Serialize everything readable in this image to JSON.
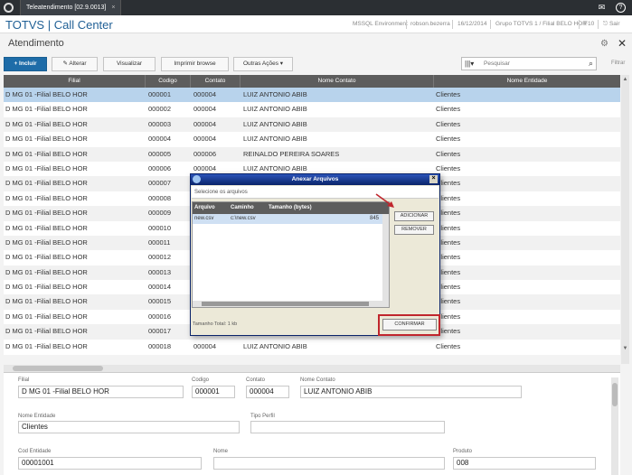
{
  "window": {
    "tab_label": "Teleatendimento [02.9.0013]",
    "tab_close": "×",
    "mail_icon": "✉",
    "help_icon": "?"
  },
  "header": {
    "brand": "TOTVS | Call Center",
    "environment": "MSSQL Environment",
    "user": "robson.bezerra",
    "date": "16/12/2014",
    "group": "Grupo TOTVS 1 / Filial BELO HOR",
    "key": "F10",
    "exit": "Sair"
  },
  "page": {
    "title": "Atendimento",
    "gear_icon": "⚙",
    "close_icon": "✕"
  },
  "toolbar": {
    "incluir": "+ Incluir",
    "alterar": "Alterar",
    "visualizar": "Visualizar",
    "imprimir": "Imprimir browse",
    "outras": "Outras Ações",
    "search_placeholder": "Pesquisar",
    "filtrar": "Filtrar"
  },
  "grid": {
    "columns": [
      "Filial",
      "Codigo",
      "Contato",
      "Nome Contato",
      "Nome Entidade"
    ],
    "rows": [
      [
        "D MG 01 -Filial BELO HOR",
        "000001",
        "000004",
        "LUIZ ANTONIO ABIB",
        "Clientes"
      ],
      [
        "D MG 01 -Filial BELO HOR",
        "000002",
        "000004",
        "LUIZ ANTONIO ABIB",
        "Clientes"
      ],
      [
        "D MG 01 -Filial BELO HOR",
        "000003",
        "000004",
        "LUIZ ANTONIO ABIB",
        "Clientes"
      ],
      [
        "D MG 01 -Filial BELO HOR",
        "000004",
        "000004",
        "LUIZ ANTONIO ABIB",
        "Clientes"
      ],
      [
        "D MG 01 -Filial BELO HOR",
        "000005",
        "000006",
        "REINALDO PEREIRA SOARES",
        "Clientes"
      ],
      [
        "D MG 01 -Filial BELO HOR",
        "000006",
        "000004",
        "LUIZ ANTONIO ABIB",
        "Clientes"
      ],
      [
        "D MG 01 -Filial BELO HOR",
        "000007",
        "",
        "",
        "Clientes"
      ],
      [
        "D MG 01 -Filial BELO HOR",
        "000008",
        "",
        "",
        "Clientes"
      ],
      [
        "D MG 01 -Filial BELO HOR",
        "000009",
        "",
        "",
        "Clientes"
      ],
      [
        "D MG 01 -Filial BELO HOR",
        "000010",
        "",
        "",
        "Clientes"
      ],
      [
        "D MG 01 -Filial BELO HOR",
        "000011",
        "",
        "",
        "Clientes"
      ],
      [
        "D MG 01 -Filial BELO HOR",
        "000012",
        "",
        "",
        "Clientes"
      ],
      [
        "D MG 01 -Filial BELO HOR",
        "000013",
        "",
        "",
        "Clientes"
      ],
      [
        "D MG 01 -Filial BELO HOR",
        "000014",
        "",
        "",
        "Clientes"
      ],
      [
        "D MG 01 -Filial BELO HOR",
        "000015",
        "",
        "",
        "Clientes"
      ],
      [
        "D MG 01 -Filial BELO HOR",
        "000016",
        "",
        "",
        "Clientes"
      ],
      [
        "D MG 01 -Filial BELO HOR",
        "000017",
        "",
        "",
        "Clientes"
      ],
      [
        "D MG 01 -Filial BELO HOR",
        "000018",
        "000004",
        "LUIZ ANTONIO ABIB",
        "Clientes"
      ]
    ]
  },
  "form": {
    "filial_label": "Filial",
    "filial_value": "D MG 01 -Filial BELO HOR",
    "codigo_label": "Codigo",
    "codigo_value": "000001",
    "contato_label": "Contato",
    "contato_value": "000004",
    "nome_contato_label": "Nome Contato",
    "nome_contato_value": "LUIZ ANTONIO ABIB",
    "nome_entidade_label": "Nome Entidade",
    "nome_entidade_value": "Clientes",
    "tipo_perfil_label": "Tipo Perfil",
    "tipo_perfil_value": "",
    "cod_entidade_label": "Cod Entidade",
    "cod_entidade_value": "00001001",
    "nome_label": "Nome",
    "nome_value": "",
    "produto_label": "Produto",
    "produto_value": "008"
  },
  "dialog": {
    "title": "Anexar Arquivos",
    "subtitle": "Selecione os arquivos",
    "columns": [
      "Arquivo",
      "Caminho",
      "Tamanho (bytes)"
    ],
    "rows": [
      {
        "arquivo": "new.csv",
        "caminho": "c:\\new.csv",
        "tamanho": "845"
      }
    ],
    "adicionar": "ADICIONAR",
    "remover": "REMOVER",
    "confirmar": "CONFIRMAR",
    "total": "Tamanho Total: 1 kb"
  },
  "colors": {
    "accent": "#1e6ca8",
    "selected_row": "#b8d3ec",
    "highlight": "#c0262d"
  }
}
